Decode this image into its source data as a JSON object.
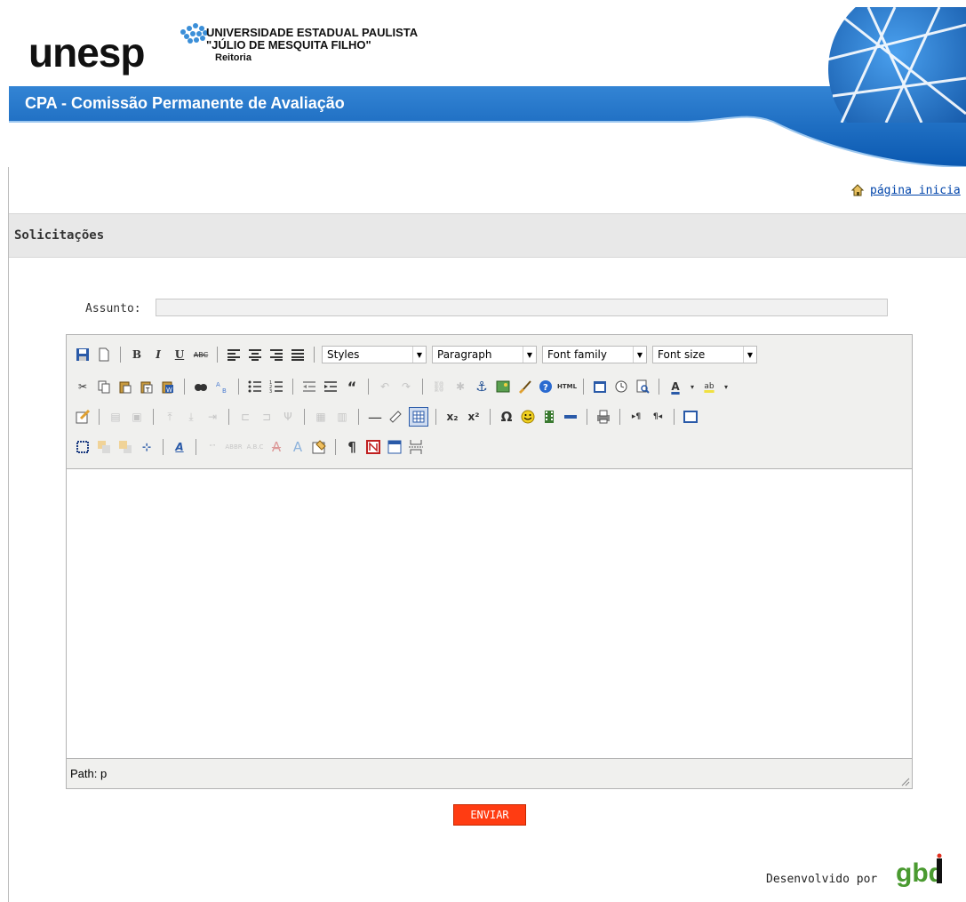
{
  "header": {
    "logo_text": "unesp",
    "university_line1": "UNIVERSIDADE ESTADUAL PAULISTA",
    "university_line2": "\"JÚLIO DE MESQUITA FILHO\"",
    "university_line3": "Reitoria",
    "banner_title": "CPA - Comissão Permanente de Avaliação"
  },
  "nav": {
    "home_link": "página inicia"
  },
  "section": {
    "title": "Solicitações"
  },
  "form": {
    "subject_label": "Assunto:",
    "subject_value": "",
    "submit_label": "ENVIAR"
  },
  "editor": {
    "styles_select": "Styles",
    "format_select": "Paragraph",
    "font_family_select": "Font family",
    "font_size_select": "Font size",
    "path_label": "Path:",
    "path_value": "p"
  },
  "footer": {
    "developed_by": "Desenvolvido por",
    "logo_text": "gbd"
  },
  "colors": {
    "banner_blue": "#1c6fc4",
    "accent_orange": "#ff3c12",
    "link_blue": "#0044aa"
  }
}
